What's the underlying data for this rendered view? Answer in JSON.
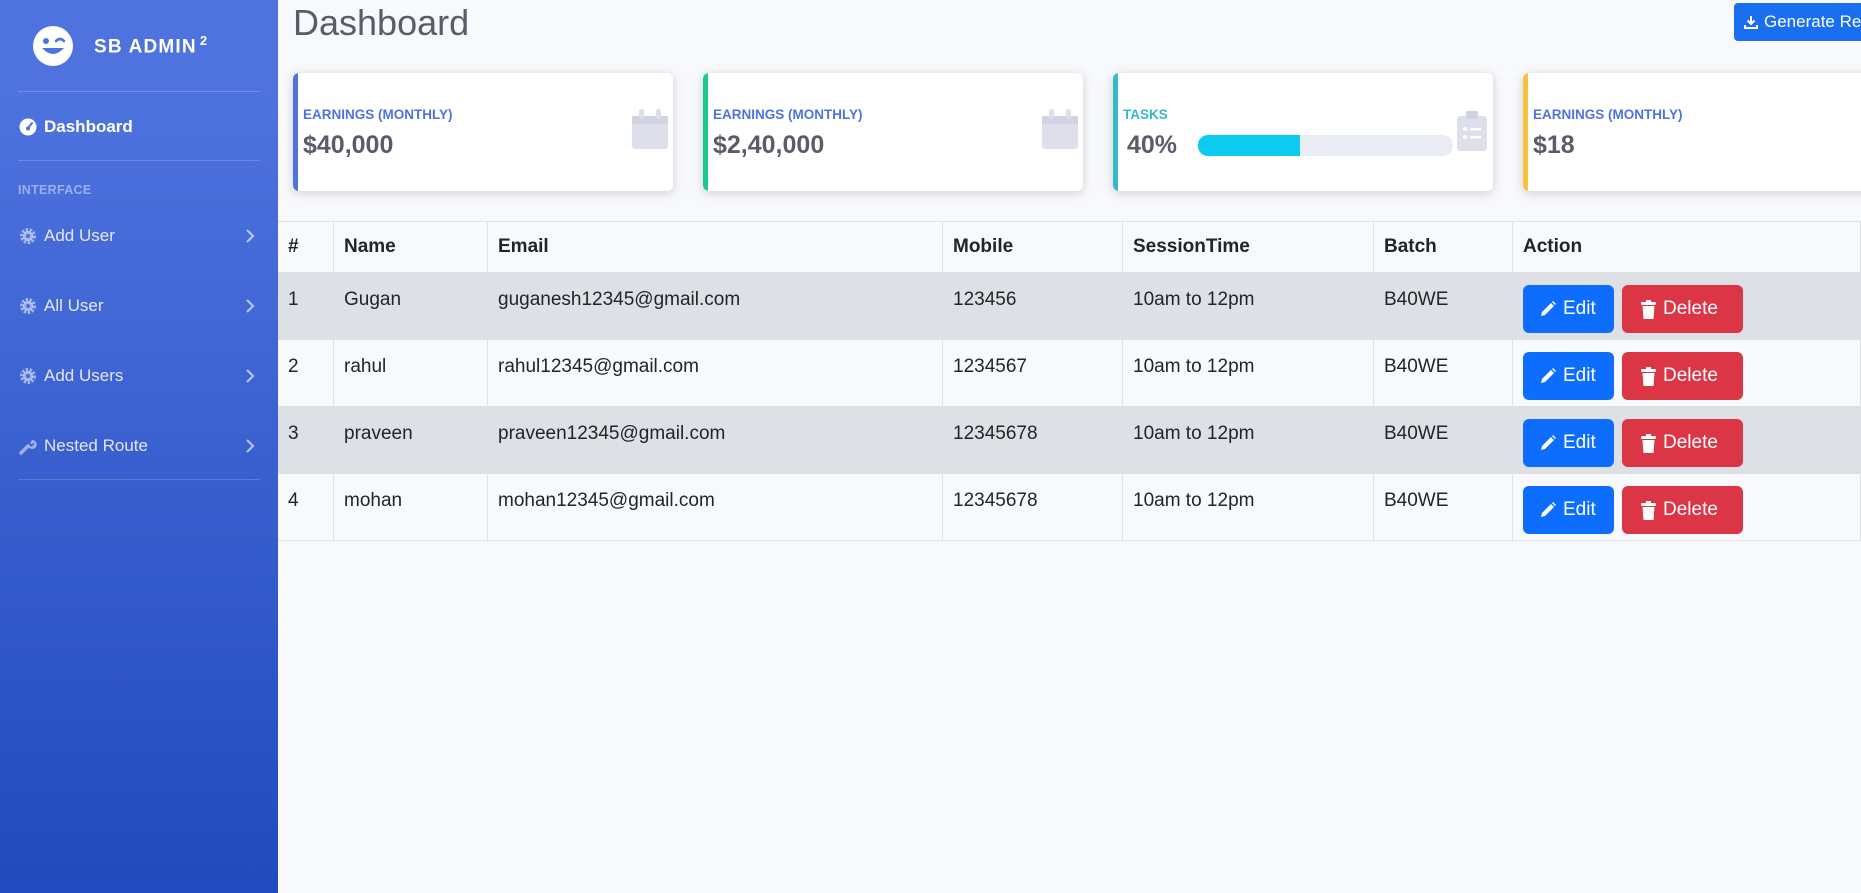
{
  "sidebar": {
    "brand": "SB ADMIN",
    "brand_sup": "2",
    "dashboard_label": "Dashboard",
    "heading": "INTERFACE",
    "items": [
      {
        "label": "Add User",
        "icon": "gear-icon"
      },
      {
        "label": "All User",
        "icon": "gear-icon"
      },
      {
        "label": "Add Users",
        "icon": "gear-icon"
      },
      {
        "label": "Nested Route",
        "icon": "wrench-icon"
      }
    ]
  },
  "header": {
    "title": "Dashboard",
    "generate_label": "Generate Re"
  },
  "cards": [
    {
      "title": "EARNINGS (MONTHLY)",
      "value": "$40,000",
      "accent": "#4e73df",
      "title_color": "#4e73df",
      "icon": "calendar-icon"
    },
    {
      "title": "EARNINGS (MONTHLY)",
      "value": "$2,40,000",
      "accent": "#1cc88a",
      "title_color": "#4e73df",
      "icon": "calendar-icon"
    },
    {
      "title": "TASKS",
      "value": "40%",
      "accent": "#36b9cc",
      "title_color": "#36b9cc",
      "icon": "clipboard-list-icon",
      "progress": 0.4
    },
    {
      "title": "EARNINGS (MONTHLY)",
      "value": "$18",
      "accent": "#f6c23e",
      "title_color": "#4e73df",
      "icon": "comments-icon"
    }
  ],
  "table": {
    "headers": [
      "#",
      "Name",
      "Email",
      "Mobile",
      "SessionTime",
      "Batch",
      "Action"
    ],
    "rows": [
      {
        "id": "1",
        "name": "Gugan",
        "email": "guganesh12345@gmail.com",
        "mobile": "123456",
        "session": "10am to 12pm",
        "batch": "B40WE"
      },
      {
        "id": "2",
        "name": "rahul",
        "email": "rahul12345@gmail.com",
        "mobile": "1234567",
        "session": "10am to 12pm",
        "batch": "B40WE"
      },
      {
        "id": "3",
        "name": "praveen",
        "email": "praveen12345@gmail.com",
        "mobile": "12345678",
        "session": "10am to 12pm",
        "batch": "B40WE"
      },
      {
        "id": "4",
        "name": "mohan",
        "email": "mohan12345@gmail.com",
        "mobile": "12345678",
        "session": "10am to 12pm",
        "batch": "B40WE"
      }
    ],
    "edit_label": "Edit",
    "delete_label": "Delete"
  }
}
